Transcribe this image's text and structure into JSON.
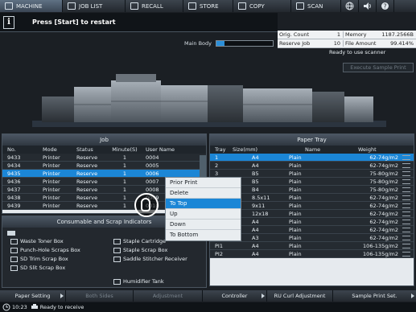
{
  "tabs": [
    {
      "label": "MACHINE",
      "icon": "machine-icon",
      "active": true
    },
    {
      "label": "JOB LIST",
      "icon": "job-list-icon"
    },
    {
      "label": "RECALL",
      "icon": "recall-icon"
    },
    {
      "label": "STORE",
      "icon": "store-icon"
    },
    {
      "label": "COPY",
      "icon": "copy-icon"
    },
    {
      "label": "SCAN",
      "icon": "scan-icon"
    }
  ],
  "message": "Press [Start] to restart",
  "status": {
    "orig_count_label": "Orig. Count",
    "orig_count": "1",
    "memory_label": "Memory",
    "memory": "1187.2566B",
    "reserve_job_label": "Reserve Job",
    "reserve_job": "10",
    "file_amount_label": "File Amount",
    "file_amount": "99.414%"
  },
  "main_body_label": "Main Body",
  "main_body_level": 0.14,
  "ready_text": "Ready to use scanner",
  "execute_sample": "Execute Sample Print",
  "job": {
    "title": "Job",
    "columns": [
      "No.",
      "Mode",
      "Status",
      "Minute(S)",
      "User Name"
    ],
    "rows": [
      [
        "9433",
        "Printer",
        "Reserve",
        "1",
        "0004"
      ],
      [
        "9434",
        "Printer",
        "Reserve",
        "1",
        "0005"
      ],
      [
        "9435",
        "Printer",
        "Reserve",
        "1",
        "0006"
      ],
      [
        "9436",
        "Printer",
        "Reserve",
        "1",
        "0007"
      ],
      [
        "9437",
        "Printer",
        "Reserve",
        "1",
        "0008"
      ],
      [
        "9438",
        "Printer",
        "Reserve",
        "1",
        "0009"
      ],
      [
        "9439",
        "Printer",
        "Reserve",
        "1",
        "0010"
      ]
    ]
  },
  "context_menu": [
    "Prior Print",
    "Delete",
    "To Top",
    "Up",
    "Down",
    "To Bottom"
  ],
  "paper": {
    "title": "Paper Tray",
    "columns": [
      "Tray",
      "Size(mm)",
      "Name",
      "Weight"
    ],
    "rows": [
      [
        "1",
        "A4",
        "Plain",
        "62-74g/m2"
      ],
      [
        "2",
        "A4",
        "Plain",
        "62-74g/m2"
      ],
      [
        "3",
        "B5",
        "Plain",
        "75-80g/m2"
      ],
      [
        "4",
        "B5",
        "Plain",
        "75-80g/m2"
      ],
      [
        "5",
        "B4",
        "Plain",
        "75-80g/m2"
      ],
      [
        "6",
        "8.5x11",
        "Plain",
        "62-74g/m2"
      ],
      [
        "7",
        "9x11",
        "Plain",
        "62-74g/m2"
      ],
      [
        "8",
        "12x18",
        "Plain",
        "62-74g/m2"
      ],
      [
        "9",
        "A4",
        "Plain",
        "62-74g/m2"
      ],
      [
        "10",
        "A4",
        "Plain",
        "62-74g/m2"
      ],
      [
        "11",
        "A3",
        "Plain",
        "62-74g/m2"
      ],
      [
        "PI1",
        "A4",
        "Plain",
        "106-135g/m2"
      ],
      [
        "PI2",
        "A4",
        "Plain",
        "106-135g/m2"
      ]
    ]
  },
  "consumable": {
    "title": "Consumable and Scrap Indicators",
    "items": [
      "Waste Toner Box",
      "Punch-Hole Scraps Box",
      "SD Trim Scrap Box",
      "SD Slit Scrap Box",
      "Staple Cartridge",
      "Staple Scrap Box",
      "Saddle Stitcher Receiver",
      "Humidifier Tank"
    ]
  },
  "bottom": [
    "Paper Setting",
    "Both Sides",
    "Adjustment",
    "Controller",
    "RU Curl Adjustment",
    "Sample Print Set."
  ],
  "statusline": {
    "time": "10:23",
    "text": "Ready to receive"
  },
  "colors": {
    "accent": "#1b86d6",
    "panel": "#252b31",
    "background": "#1b1f24"
  }
}
